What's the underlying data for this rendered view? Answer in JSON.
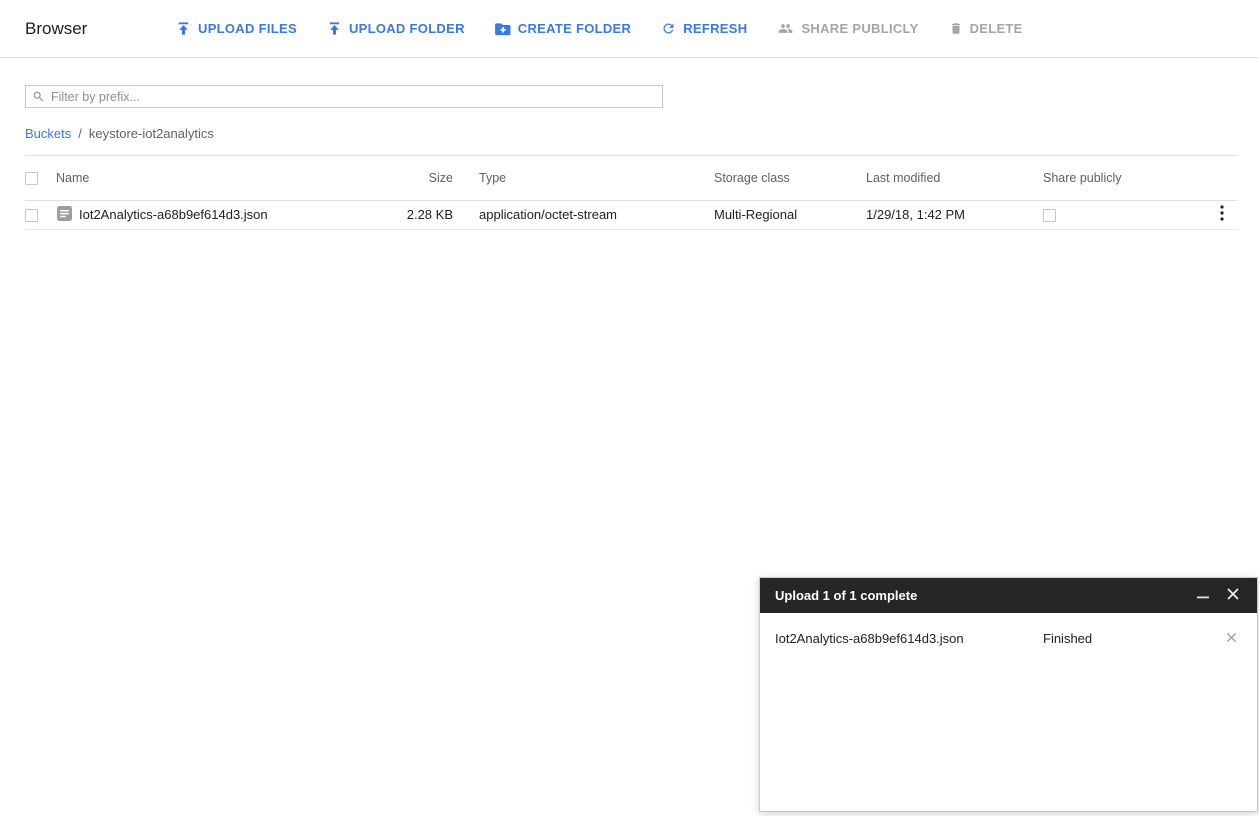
{
  "header": {
    "title": "Browser",
    "buttons": [
      {
        "label": "UPLOAD FILES",
        "icon": "upload-icon",
        "enabled": true
      },
      {
        "label": "UPLOAD FOLDER",
        "icon": "upload-icon",
        "enabled": true
      },
      {
        "label": "CREATE FOLDER",
        "icon": "create-folder-icon",
        "enabled": true
      },
      {
        "label": "REFRESH",
        "icon": "refresh-icon",
        "enabled": true
      },
      {
        "label": "SHARE PUBLICLY",
        "icon": "people-icon",
        "enabled": false
      },
      {
        "label": "DELETE",
        "icon": "trash-icon",
        "enabled": false
      }
    ]
  },
  "filter": {
    "placeholder": "Filter by prefix..."
  },
  "breadcrumb": {
    "link": "Buckets",
    "separator": "/",
    "current": "keystore-iot2analytics"
  },
  "table": {
    "columns": {
      "name": "Name",
      "size": "Size",
      "type": "Type",
      "storage_class": "Storage class",
      "last_modified": "Last modified",
      "share_publicly": "Share publicly"
    },
    "rows": [
      {
        "name": "Iot2Analytics-a68b9ef614d3.json",
        "size": "2.28 KB",
        "type": "application/octet-stream",
        "storage_class": "Multi-Regional",
        "last_modified": "1/29/18, 1:42 PM"
      }
    ]
  },
  "upload_dialog": {
    "title": "Upload 1 of 1 complete",
    "items": [
      {
        "name": "Iot2Analytics-a68b9ef614d3.json",
        "status": "Finished"
      }
    ]
  },
  "colors": {
    "accent_blue": "#3b78e7",
    "disabled_gray": "#a5a5a5",
    "dialog_header_bg": "#262626",
    "divider": "#e0e0e0"
  }
}
